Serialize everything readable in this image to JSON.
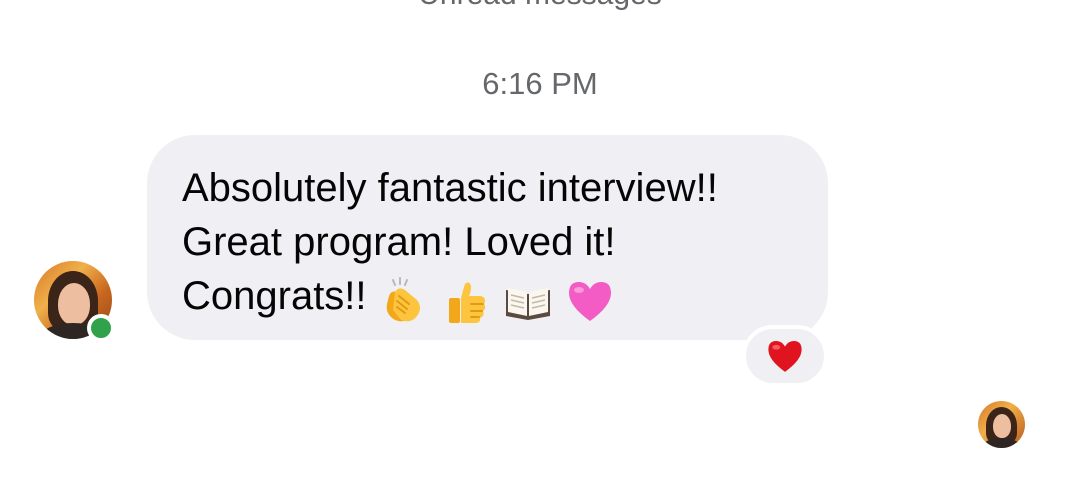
{
  "header": {
    "divider_label": "Unread messages",
    "timestamp": "6:16 PM"
  },
  "message": {
    "lines": [
      "Absolutely fantastic interview!!",
      "Great program! Loved it!",
      "Congrats!!"
    ],
    "emojis": [
      "clapping-hands-emoji",
      "thumbs-up-emoji",
      "open-book-emoji",
      "pink-heart-emoji"
    ],
    "reaction": "red-heart-emoji"
  },
  "sender": {
    "online": true,
    "status_color": "#31a24c"
  },
  "colors": {
    "bubble": "#f0f0f4",
    "muted_text": "#65676b",
    "text": "#050505"
  }
}
